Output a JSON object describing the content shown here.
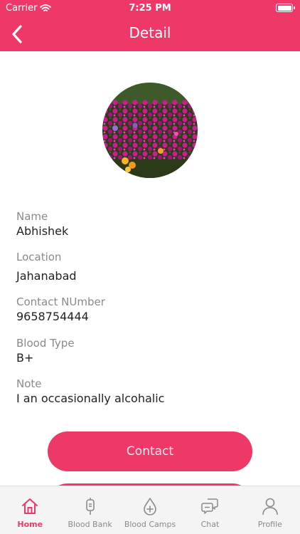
{
  "status_bar": {
    "carrier": "Carrier",
    "time": "7:25 PM"
  },
  "header": {
    "title": "Detail",
    "back_icon": "chevron-left-icon"
  },
  "colors": {
    "accent": "#ee3968",
    "label": "#8a8a8a",
    "value": "#222222",
    "tab_inactive": "#8a8a8a"
  },
  "details": [
    {
      "label": "Name",
      "value": "Abhishek"
    },
    {
      "label": "Location",
      "value": "Jahanabad"
    },
    {
      "label": "Contact NUmber",
      "value": "9658754444"
    },
    {
      "label": "Blood Type",
      "value": "B+"
    },
    {
      "label": "Note",
      "value": "I an occasionally alcohalic"
    }
  ],
  "actions": {
    "contact_label": "Contact"
  },
  "tabs": [
    {
      "label": "Home",
      "icon": "home-icon",
      "active": true
    },
    {
      "label": "Blood Bank",
      "icon": "blood-bag-icon",
      "active": false
    },
    {
      "label": "Blood Camps",
      "icon": "blood-drop-plus-icon",
      "active": false
    },
    {
      "label": "Chat",
      "icon": "chat-bubbles-icon",
      "active": false
    },
    {
      "label": "Profile",
      "icon": "user-icon",
      "active": false
    }
  ]
}
